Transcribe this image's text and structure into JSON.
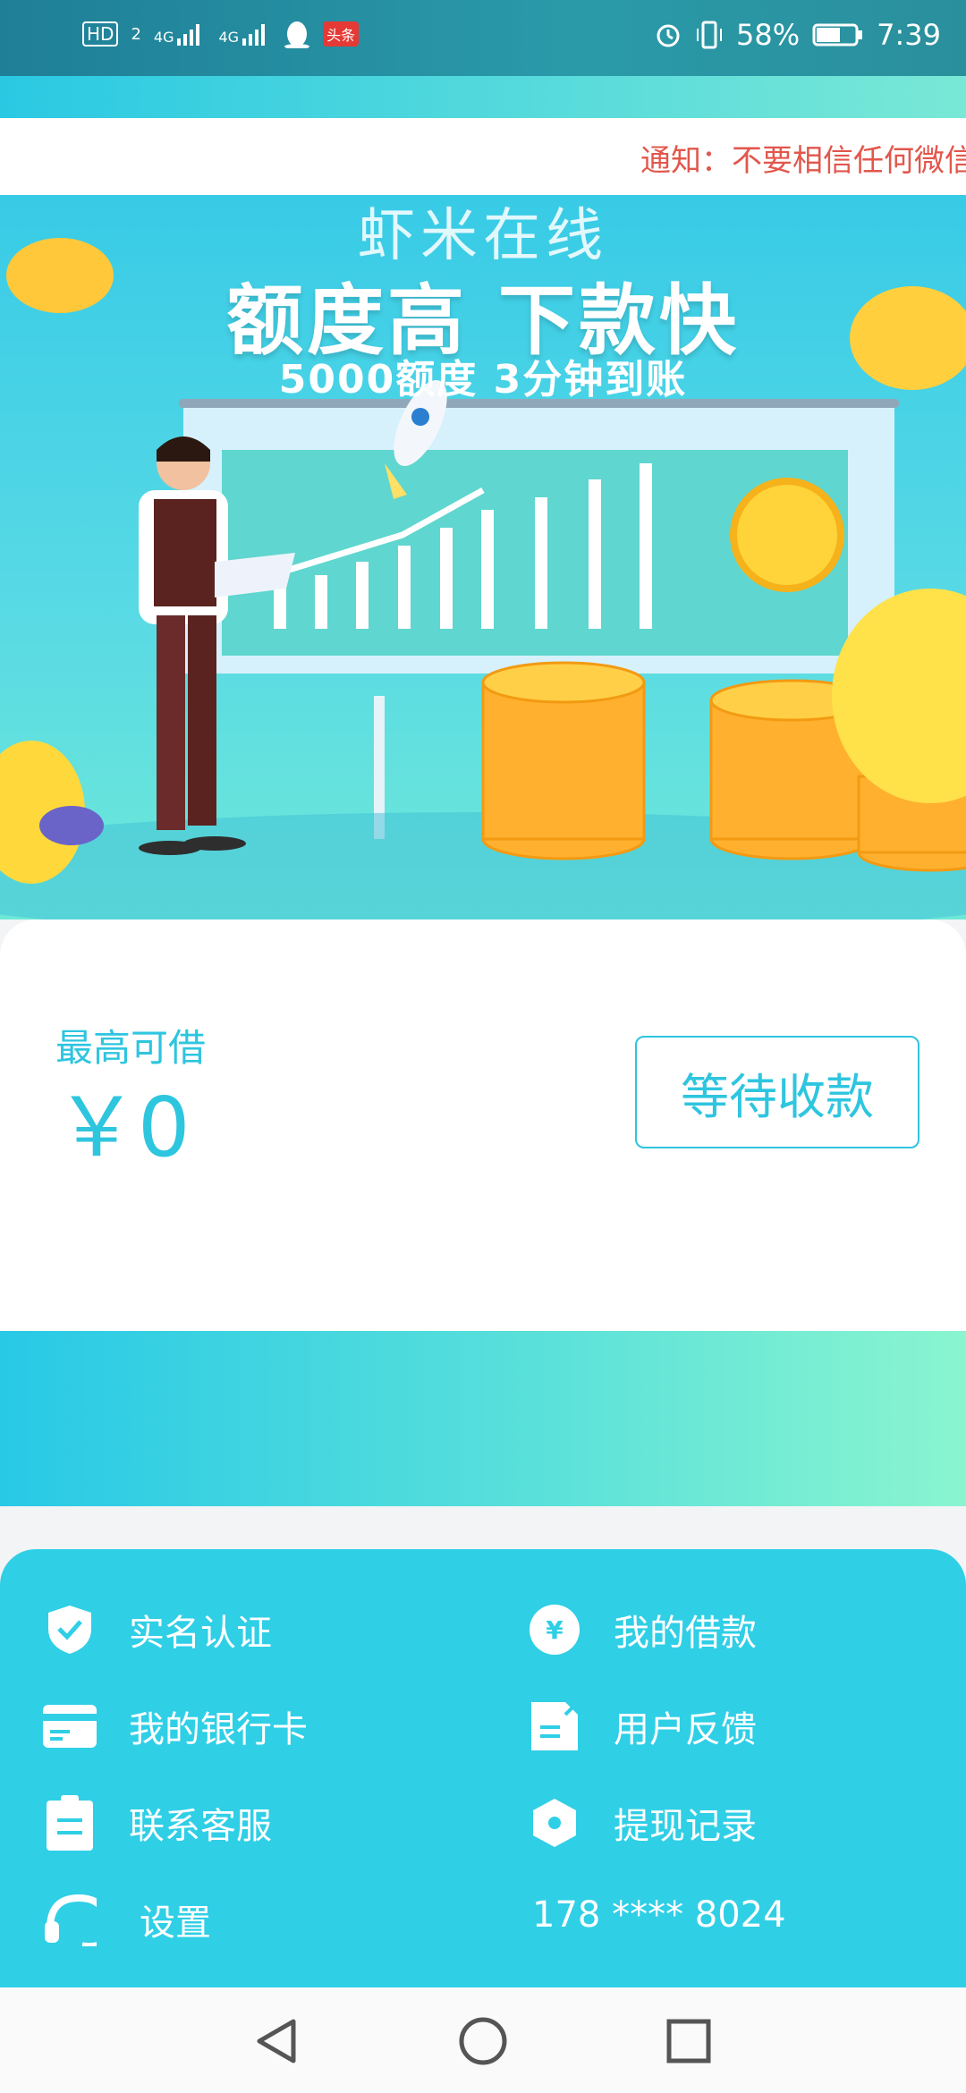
{
  "status_bar": {
    "hd": "HD",
    "sim": "2",
    "net1": "4G",
    "net2": "4G",
    "app_badge": "头条",
    "battery": "58%",
    "time": "7:39"
  },
  "notice": {
    "text": "通知：不要相信任何微信"
  },
  "banner": {
    "brand": "虾米在线",
    "title": "额度高 下款快",
    "subtitle": "5000额度 3分钟到账"
  },
  "loan_card": {
    "max_label": "最高可借",
    "max_amount": "￥0",
    "wait_button": "等待收款"
  },
  "menu": {
    "items": [
      {
        "label": "实名认证",
        "icon": "shield-check-icon"
      },
      {
        "label": "我的借款",
        "icon": "yen-icon"
      },
      {
        "label": "我的银行卡",
        "icon": "bank-card-icon"
      },
      {
        "label": "用户反馈",
        "icon": "feedback-icon"
      },
      {
        "label": "联系客服",
        "icon": "clipboard-icon"
      },
      {
        "label": "提现记录",
        "icon": "hexagon-icon"
      },
      {
        "label": "设置",
        "icon": "headset-icon"
      }
    ],
    "phone": "178 **** 8024"
  },
  "colors": {
    "accent": "#2ec5df",
    "menu_bg": "#2fcfe6",
    "notice": "#e2574c"
  }
}
